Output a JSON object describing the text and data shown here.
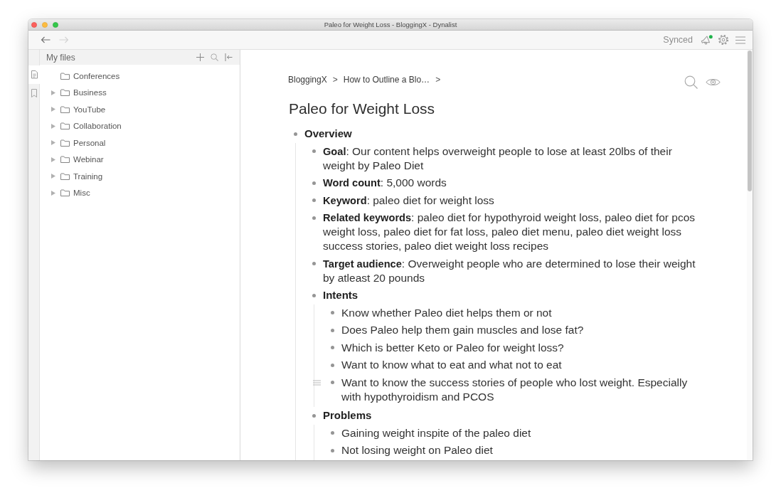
{
  "window": {
    "title": "Paleo for Weight Loss - BloggingX - Dynalist"
  },
  "toolbar": {
    "back": {
      "disabled": false
    },
    "forward": {
      "disabled": true
    },
    "sync_status": "Synced",
    "notifications": {
      "unread": true
    }
  },
  "rail": [
    {
      "kind": "files",
      "selected": true
    },
    {
      "kind": "bookmarks",
      "selected": false
    }
  ],
  "sidebar": {
    "header": "My files",
    "items": [
      {
        "label": "Conferences",
        "has_children": false
      },
      {
        "label": "Business",
        "has_children": true
      },
      {
        "label": "YouTube",
        "has_children": true
      },
      {
        "label": "Collaboration",
        "has_children": true
      },
      {
        "label": "Personal",
        "has_children": true
      },
      {
        "label": "Webinar",
        "has_children": true
      },
      {
        "label": "Training",
        "has_children": true
      },
      {
        "label": "Misc",
        "has_children": true
      }
    ]
  },
  "document": {
    "breadcrumb": [
      {
        "label": "BloggingX",
        "separator": ">"
      },
      {
        "label": "How to Outline a Blo…",
        "separator": ">"
      }
    ],
    "title": "Paleo for Weight Loss",
    "outline": [
      {
        "kind": "heading",
        "text": "Overview",
        "hovered": false,
        "children": [
          {
            "kind": "item",
            "text": "**Goal**: Our content helps overweight people to lose at least 20lbs of their weight by Paleo Diet",
            "hovered": false
          },
          {
            "kind": "item",
            "text": "**Word count**: 5,000 words",
            "hovered": false
          },
          {
            "kind": "item",
            "text": "**Keyword**: paleo diet for weight loss",
            "hovered": false
          },
          {
            "kind": "item",
            "text": "**Related keywords**: paleo diet for hypothyroid weight loss, paleo diet for pcos weight loss, paleo diet for fat loss, paleo diet menu, paleo diet weight loss success stories, paleo diet weight loss recipes",
            "hovered": false
          },
          {
            "kind": "item",
            "text": "**Target audience**: Overweight people who are determined to lose their weight by atleast 20 pounds",
            "hovered": false
          },
          {
            "kind": "heading",
            "text": "Intents",
            "hovered": false,
            "children": [
              {
                "kind": "item",
                "text": "Know whether Paleo diet helps them or not",
                "hovered": false
              },
              {
                "kind": "item",
                "text": "Does Paleo help them gain muscles and lose fat?",
                "hovered": false
              },
              {
                "kind": "item",
                "text": "Which is better Keto or Paleo for weight loss?",
                "hovered": false
              },
              {
                "kind": "item",
                "text": "Want to know what to eat and what not to eat",
                "hovered": false
              },
              {
                "kind": "item",
                "text": "Want to know the success stories of people who lost weight. Especially with hypothyroidism and PCOS",
                "hovered": true
              }
            ]
          },
          {
            "kind": "heading",
            "text": "Problems",
            "hovered": false,
            "children": [
              {
                "kind": "item",
                "text": "Gaining weight inspite of the paleo diet",
                "hovered": false
              },
              {
                "kind": "item",
                "text": "Not losing weight on Paleo diet",
                "hovered": false
              }
            ]
          }
        ]
      }
    ]
  }
}
